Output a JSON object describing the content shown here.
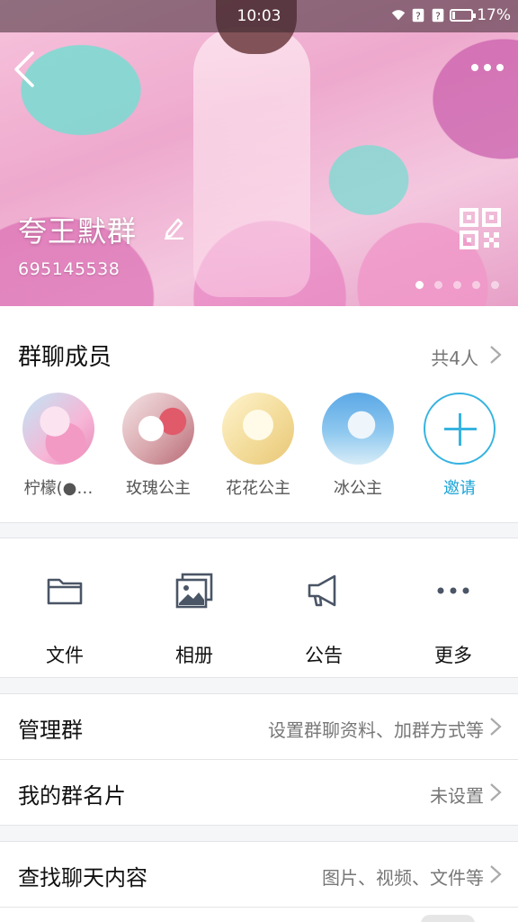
{
  "status_bar": {
    "time": "10:03",
    "battery": "17%",
    "battery_level": 0.17
  },
  "header": {
    "group_name": "夸王默群",
    "group_id": "695145538",
    "page_indicator": {
      "count": 5,
      "active": 1
    },
    "icons": {
      "back": "chevron-left-icon",
      "more": "more-dots-icon",
      "edit": "pencil-icon",
      "qr": "qr-code-icon"
    }
  },
  "members": {
    "title": "群聊成员",
    "count_label": "共4人",
    "list": [
      {
        "name": "柠檬(●…"
      },
      {
        "name": "玫瑰公主"
      },
      {
        "name": "花花公主"
      },
      {
        "name": "冰公主"
      }
    ],
    "invite_label": "邀请"
  },
  "actions": [
    {
      "label": "文件",
      "icon": "folder-icon"
    },
    {
      "label": "相册",
      "icon": "photo-album-icon"
    },
    {
      "label": "公告",
      "icon": "megaphone-icon"
    },
    {
      "label": "更多",
      "icon": "more-dots-icon"
    }
  ],
  "rows": {
    "manage": {
      "title": "管理群",
      "value": "设置群聊资料、加群方式等"
    },
    "card": {
      "title": "我的群名片",
      "value": "未设置"
    },
    "search": {
      "title": "查找聊天内容",
      "value": "图片、视频、文件等"
    }
  },
  "colors": {
    "accent": "#1aa3d6",
    "background": "#f5f6f8",
    "icon_gray": "#4a5566"
  }
}
